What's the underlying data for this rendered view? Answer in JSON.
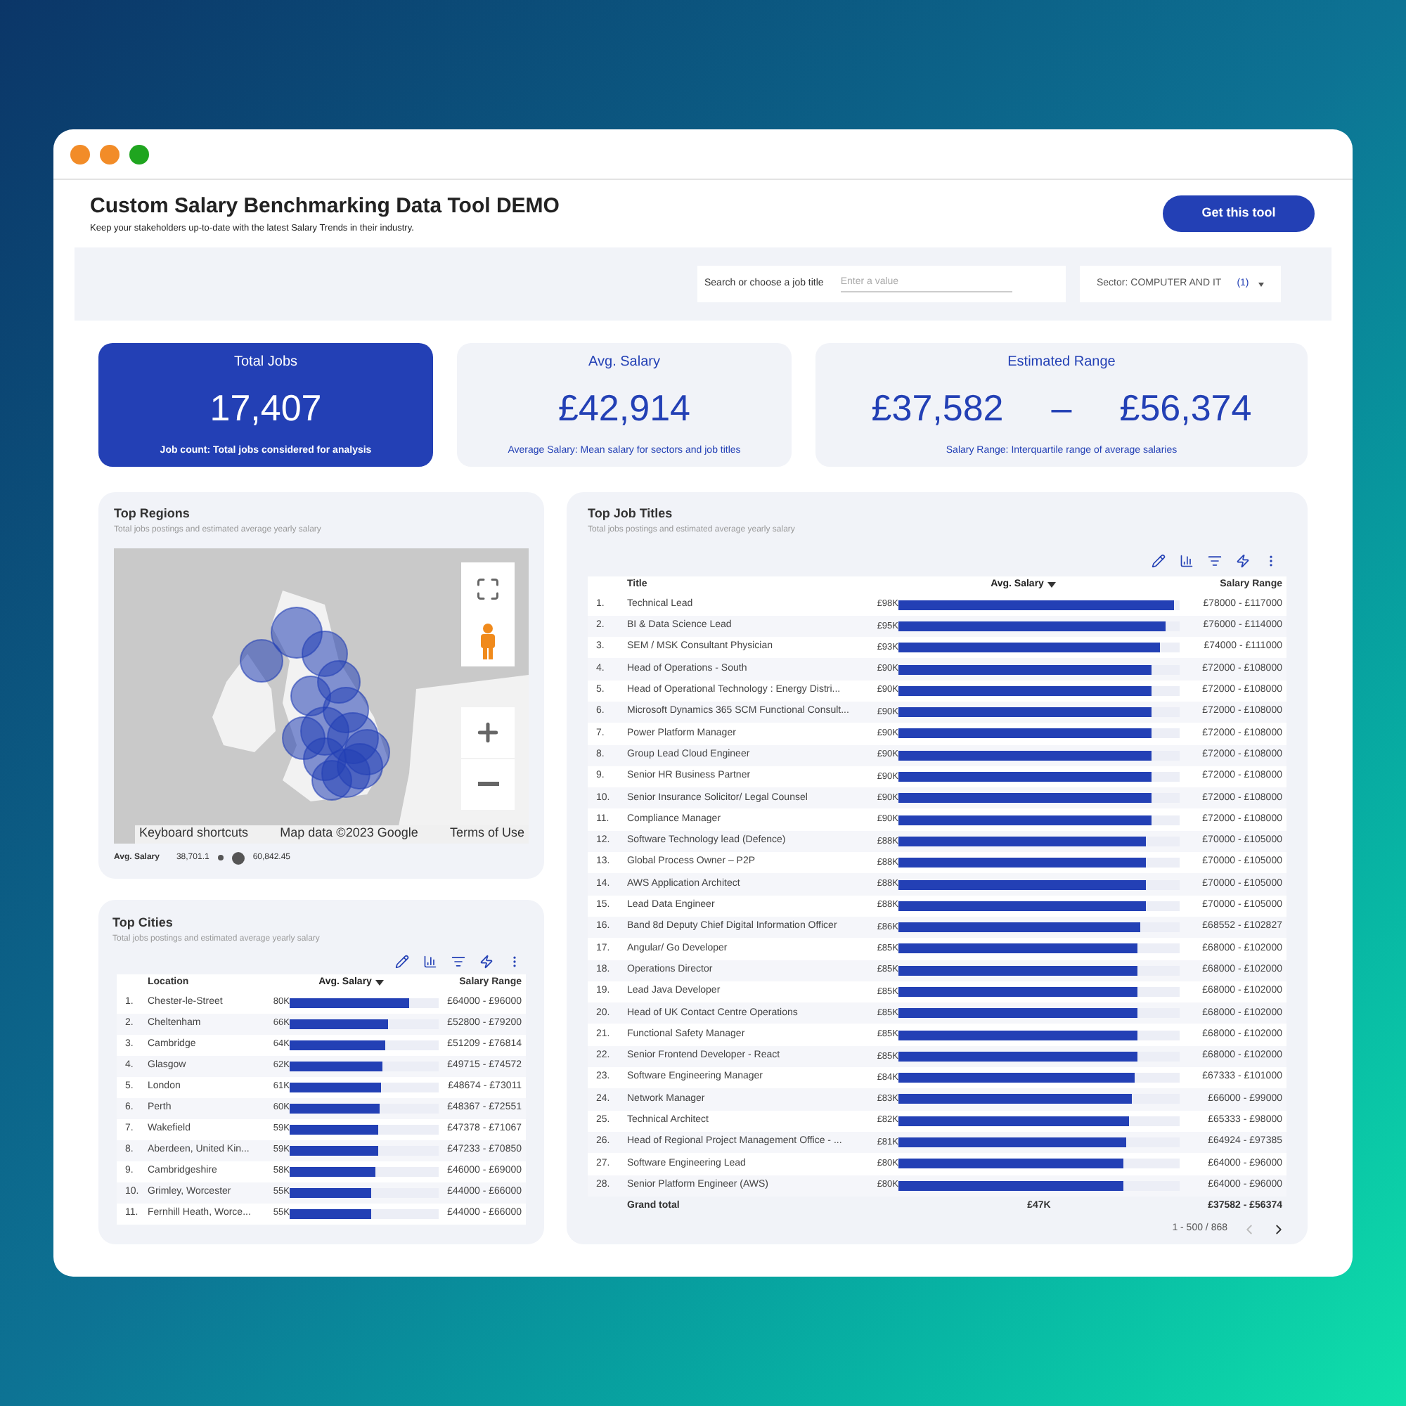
{
  "window": {
    "buttons": [
      {
        "color": "#f28c28"
      },
      {
        "color": "#f28c28"
      },
      {
        "color": "#1fa51f"
      }
    ]
  },
  "header": {
    "title": "Custom Salary Benchmarking Data Tool DEMO",
    "subtitle": "Keep your stakeholders up-to-date with the latest Salary Trends in their industry.",
    "button": "Get this tool"
  },
  "filters": {
    "search": {
      "label": "Search or choose a job title",
      "placeholder": "Enter a value"
    },
    "sector": {
      "label": "Sector:",
      "value": "COMPUTER AND IT",
      "count": "(1)"
    }
  },
  "kpis": [
    {
      "kind": "highlight",
      "title": "Total Jobs",
      "value": "17,407",
      "caption": "Job count: Total jobs considered for analysis"
    },
    {
      "kind": "plain",
      "title": "Avg. Salary",
      "value": "£42,914",
      "caption": "Average Salary: Mean salary for sectors and job titles"
    },
    {
      "kind": "range",
      "title": "Estimated Range",
      "low": "£37,582",
      "dash": "–",
      "high": "£56,374",
      "caption": "Salary Range: Interquartile range of average salaries"
    }
  ],
  "regions": {
    "title": "Top Regions",
    "subtitle": "Total jobs postings and estimated average yearly salary",
    "attribution": [
      "Keyboard shortcuts",
      "Map data ©2023 Google",
      "Terms of Use"
    ],
    "legend": {
      "label": "Avg. Salary",
      "min": "38,701.1",
      "max": "60,842.45"
    }
  },
  "cities": {
    "title": "Top Cities",
    "subtitle": "Total jobs postings and estimated average yearly salary",
    "columns": [
      {
        "label": "Location",
        "sorted": false
      },
      {
        "label": "Avg. Salary",
        "sorted": true
      },
      {
        "label": "Salary Range",
        "sorted": false
      }
    ],
    "rows": [
      {
        "rank": "1.",
        "name": "Chester-le-Street",
        "value": "80K",
        "level": 0.8,
        "range": "£64000 - £96000"
      },
      {
        "rank": "2.",
        "name": "Cheltenham",
        "value": "66K",
        "level": 0.66,
        "range": "£52800 - £79200"
      },
      {
        "rank": "3.",
        "name": "Cambridge",
        "value": "64K",
        "level": 0.64,
        "range": "£51209 - £76814"
      },
      {
        "rank": "4.",
        "name": "Glasgow",
        "value": "62K",
        "level": 0.62,
        "range": "£49715 - £74572"
      },
      {
        "rank": "5.",
        "name": "London",
        "value": "61K",
        "level": 0.61,
        "range": "£48674 - £73011"
      },
      {
        "rank": "6.",
        "name": "Perth",
        "value": "60K",
        "level": 0.6,
        "range": "£48367 - £72551"
      },
      {
        "rank": "7.",
        "name": "Wakefield",
        "value": "59K",
        "level": 0.59,
        "range": "£47378 - £71067"
      },
      {
        "rank": "8.",
        "name": "Aberdeen, United Kin...",
        "value": "59K",
        "level": 0.59,
        "range": "£47233 - £70850"
      },
      {
        "rank": "9.",
        "name": "Cambridgeshire",
        "value": "58K",
        "level": 0.58,
        "range": "£46000 - £69000"
      },
      {
        "rank": "10.",
        "name": "Grimley, Worcester",
        "value": "55K",
        "level": 0.55,
        "range": "£44000 - £66000"
      },
      {
        "rank": "11.",
        "name": "Fernhill Heath, Worce...",
        "value": "55K",
        "level": 0.55,
        "range": "£44000 - £66000"
      }
    ]
  },
  "job_titles": {
    "title": "Top Job Titles",
    "subtitle": "Total jobs postings and estimated average yearly salary",
    "columns": [
      {
        "label": "Title",
        "sorted": false
      },
      {
        "label": "Avg. Salary",
        "sorted": true
      },
      {
        "label": "Salary Range",
        "sorted": false
      }
    ],
    "rows": [
      {
        "rank": "1.",
        "name": "Technical Lead",
        "value": "£98K",
        "level": 0.98,
        "range": "£78000 - £117000"
      },
      {
        "rank": "2.",
        "name": "BI & Data Science Lead",
        "value": "£95K",
        "level": 0.95,
        "range": "£76000 - £114000"
      },
      {
        "rank": "3.",
        "name": "SEM / MSK Consultant Physician",
        "value": "£93K",
        "level": 0.93,
        "range": "£74000 - £111000"
      },
      {
        "rank": "4.",
        "name": "Head of Operations - South",
        "value": "£90K",
        "level": 0.9,
        "range": "£72000 - £108000"
      },
      {
        "rank": "5.",
        "name": "Head of Operational Technology : Energy Distri...",
        "value": "£90K",
        "level": 0.9,
        "range": "£72000 - £108000"
      },
      {
        "rank": "6.",
        "name": "Microsoft Dynamics 365 SCM Functional Consult...",
        "value": "£90K",
        "level": 0.9,
        "range": "£72000 - £108000"
      },
      {
        "rank": "7.",
        "name": "Power Platform Manager",
        "value": "£90K",
        "level": 0.9,
        "range": "£72000 - £108000"
      },
      {
        "rank": "8.",
        "name": "Group Lead Cloud Engineer",
        "value": "£90K",
        "level": 0.9,
        "range": "£72000 - £108000"
      },
      {
        "rank": "9.",
        "name": "Senior HR Business Partner",
        "value": "£90K",
        "level": 0.9,
        "range": "£72000 - £108000"
      },
      {
        "rank": "10.",
        "name": "Senior Insurance Solicitor/ Legal Counsel",
        "value": "£90K",
        "level": 0.9,
        "range": "£72000 - £108000"
      },
      {
        "rank": "11.",
        "name": "Compliance Manager",
        "value": "£90K",
        "level": 0.9,
        "range": "£72000 - £108000"
      },
      {
        "rank": "12.",
        "name": "Software Technology lead (Defence)",
        "value": "£88K",
        "level": 0.88,
        "range": "£70000 - £105000"
      },
      {
        "rank": "13.",
        "name": "Global Process Owner – P2P",
        "value": "£88K",
        "level": 0.88,
        "range": "£70000 - £105000"
      },
      {
        "rank": "14.",
        "name": "AWS Application Architect",
        "value": "£88K",
        "level": 0.88,
        "range": "£70000 - £105000"
      },
      {
        "rank": "15.",
        "name": "Lead Data Engineer",
        "value": "£88K",
        "level": 0.88,
        "range": "£70000 - £105000"
      },
      {
        "rank": "16.",
        "name": "Band 8d Deputy Chief Digital Information Officer",
        "value": "£86K",
        "level": 0.86,
        "range": "£68552 - £102827"
      },
      {
        "rank": "17.",
        "name": "Angular/ Go Developer",
        "value": "£85K",
        "level": 0.85,
        "range": "£68000 - £102000"
      },
      {
        "rank": "18.",
        "name": "Operations Director",
        "value": "£85K",
        "level": 0.85,
        "range": "£68000 - £102000"
      },
      {
        "rank": "19.",
        "name": "Lead Java Developer",
        "value": "£85K",
        "level": 0.85,
        "range": "£68000 - £102000"
      },
      {
        "rank": "20.",
        "name": "Head of UK Contact Centre Operations",
        "value": "£85K",
        "level": 0.85,
        "range": "£68000 - £102000"
      },
      {
        "rank": "21.",
        "name": "Functional Safety Manager",
        "value": "£85K",
        "level": 0.85,
        "range": "£68000 - £102000"
      },
      {
        "rank": "22.",
        "name": "Senior Frontend Developer - React",
        "value": "£85K",
        "level": 0.85,
        "range": "£68000 - £102000"
      },
      {
        "rank": "23.",
        "name": "Software Engineering Manager",
        "value": "£84K",
        "level": 0.84,
        "range": "£67333 - £101000"
      },
      {
        "rank": "24.",
        "name": "Network Manager",
        "value": "£83K",
        "level": 0.83,
        "range": "£66000 - £99000"
      },
      {
        "rank": "25.",
        "name": "Technical Architect",
        "value": "£82K",
        "level": 0.82,
        "range": "£65333 - £98000"
      },
      {
        "rank": "26.",
        "name": "Head of Regional Project Management Office - ...",
        "value": "£81K",
        "level": 0.81,
        "range": "£64924 - £97385"
      },
      {
        "rank": "27.",
        "name": "Software Engineering Lead",
        "value": "£80K",
        "level": 0.8,
        "range": "£64000 - £96000"
      },
      {
        "rank": "28.",
        "name": "Senior Platform Engineer (AWS)",
        "value": "£80K",
        "level": 0.8,
        "range": "£64000 - £96000"
      }
    ],
    "total": {
      "label": "Grand total",
      "value": "£47K",
      "range": "£37582 - £56374"
    },
    "pagination": {
      "text": "1 - 500 / 868",
      "prev_disabled": true,
      "next_disabled": false
    }
  }
}
